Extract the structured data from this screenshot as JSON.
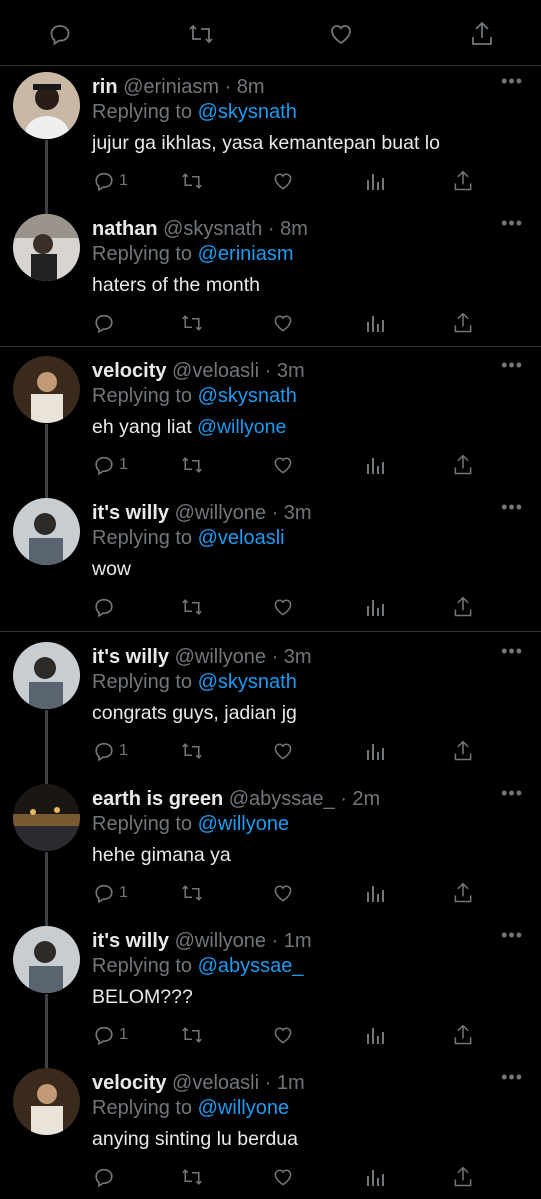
{
  "top_actions": [
    "reply-icon",
    "retweet-icon",
    "like-icon",
    "share-icon"
  ],
  "tweets": [
    {
      "name": "rin",
      "handle": "@eriniasm",
      "time": "· 8m",
      "replying_prefix": "Replying to ",
      "replying_to": "@skysnath",
      "text": "jujur ga ikhlas, yasa kemantepan buat lo",
      "mention": "",
      "reply_count": "1",
      "more": "•••"
    },
    {
      "name": "nathan",
      "handle": "@skysnath",
      "time": "· 8m",
      "replying_prefix": "Replying to ",
      "replying_to": "@eriniasm",
      "text": "haters of the month",
      "mention": "",
      "reply_count": "",
      "more": "•••"
    },
    {
      "name": "velocity",
      "handle": "@veloasli",
      "time": "· 3m",
      "replying_prefix": "Replying to ",
      "replying_to": "@skysnath",
      "text": "eh yang liat ",
      "mention": "@willyone",
      "reply_count": "1",
      "more": "•••"
    },
    {
      "name": "it's willy",
      "handle": "@willyone",
      "time": "· 3m",
      "replying_prefix": "Replying to ",
      "replying_to": "@veloasli",
      "text": "wow",
      "mention": "",
      "reply_count": "",
      "more": "•••"
    },
    {
      "name": "it's willy",
      "handle": "@willyone",
      "time": "· 3m",
      "replying_prefix": "Replying to ",
      "replying_to": "@skysnath",
      "text": "congrats guys, jadian jg",
      "mention": "",
      "reply_count": "1",
      "more": "•••"
    },
    {
      "name": "earth is green",
      "handle": "@abyssae_",
      "time": "· 2m",
      "replying_prefix": "Replying to ",
      "replying_to": "@willyone",
      "text": "hehe gimana ya",
      "mention": "",
      "reply_count": "1",
      "more": "•••"
    },
    {
      "name": "it's willy",
      "handle": "@willyone",
      "time": "· 1m",
      "replying_prefix": "Replying to ",
      "replying_to": "@abyssae_",
      "text": "BELOM???",
      "mention": "",
      "reply_count": "1",
      "more": "•••"
    },
    {
      "name": "velocity",
      "handle": "@veloasli",
      "time": "· 1m",
      "replying_prefix": "Replying to ",
      "replying_to": "@willyone",
      "text": "anying sinting lu berdua",
      "mention": "",
      "reply_count": "",
      "more": "•••"
    }
  ],
  "colors": {
    "background": "#000000",
    "text": "#e7e9ea",
    "muted": "#71767b",
    "link": "#1d9bf0",
    "divider": "#2f3336"
  }
}
